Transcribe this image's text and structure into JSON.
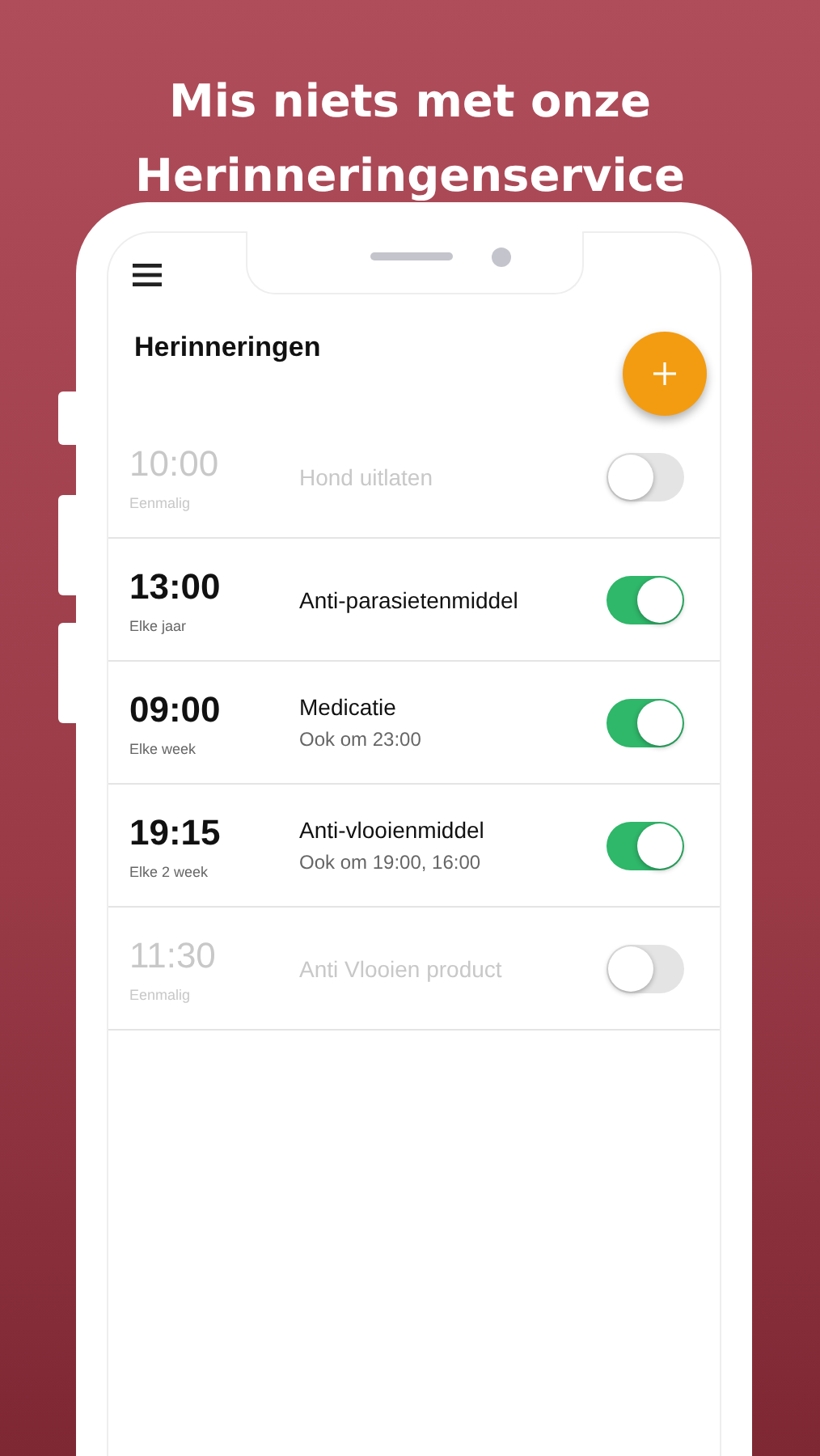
{
  "headline": [
    "Mis niets met onze",
    "Herinneringenservice"
  ],
  "screen": {
    "title": "Herinneringen"
  },
  "reminders": [
    {
      "time": "10:00",
      "repeat": "Eenmalig",
      "name": "Hond uitlaten",
      "on": false
    },
    {
      "time": "13:00",
      "repeat": "Elke jaar",
      "name": "Anti-parasietenmiddel",
      "on": true
    },
    {
      "time": "09:00",
      "repeat": "Elke week",
      "name": "Medicatie",
      "also": "Ook om 23:00",
      "on": true
    },
    {
      "time": "19:15",
      "repeat": "Elke 2 week",
      "name": "Anti-vlooienmiddel",
      "also": "Ook om 19:00, 16:00",
      "on": true
    },
    {
      "time": "11:30",
      "repeat": "Eenmalig",
      "name": "Anti Vlooien product",
      "on": false
    }
  ]
}
